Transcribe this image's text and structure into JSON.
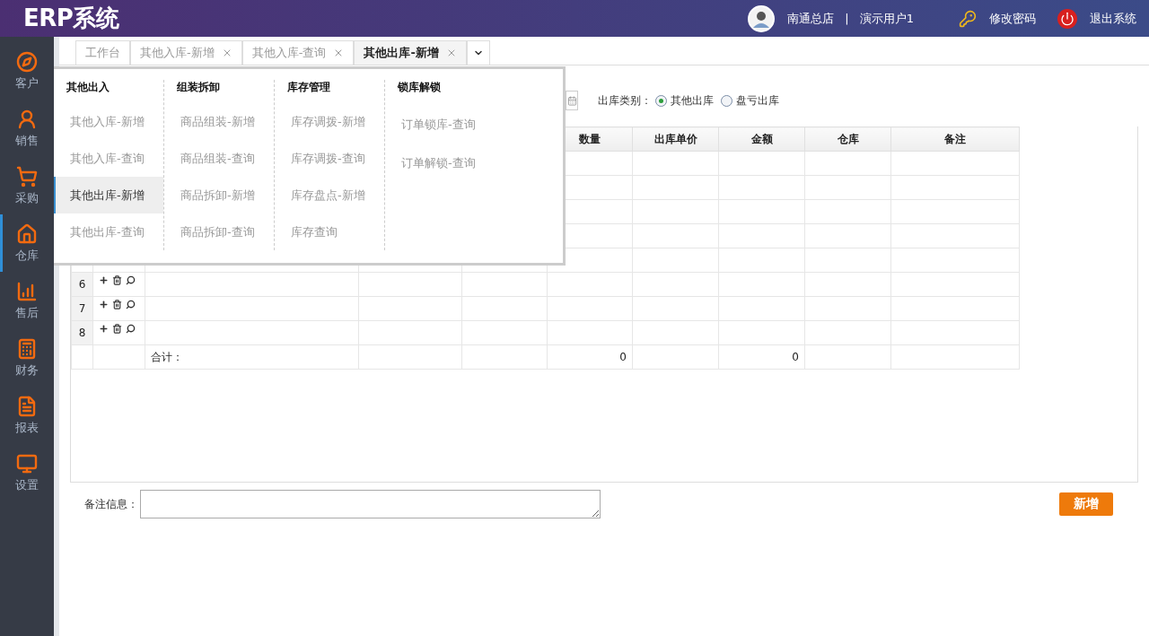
{
  "header": {
    "title": "ERP系统",
    "store": "南通总店",
    "separator": "|",
    "user": "演示用户1",
    "change_password": "修改密码",
    "logout": "退出系统"
  },
  "sidebar": {
    "items": [
      {
        "label": "客户",
        "selected": false
      },
      {
        "label": "销售",
        "selected": false
      },
      {
        "label": "采购",
        "selected": false
      },
      {
        "label": "仓库",
        "selected": true
      },
      {
        "label": "售后",
        "selected": false
      },
      {
        "label": "财务",
        "selected": false
      },
      {
        "label": "报表",
        "selected": false
      },
      {
        "label": "设置",
        "selected": false
      }
    ]
  },
  "tabs": [
    {
      "label": "工作台",
      "closable": false,
      "selected": false
    },
    {
      "label": "其他入库-新增",
      "closable": true,
      "selected": false
    },
    {
      "label": "其他入库-查询",
      "closable": true,
      "selected": false
    },
    {
      "label": "其他出库-新增",
      "closable": true,
      "selected": true
    }
  ],
  "menu": {
    "groups": [
      {
        "heading": "其他出入",
        "items": [
          {
            "label": "其他入库-新增",
            "selected": false
          },
          {
            "label": "其他入库-查询",
            "selected": false
          },
          {
            "label": "其他出库-新增",
            "selected": true
          },
          {
            "label": "其他出库-查询",
            "selected": false
          }
        ]
      },
      {
        "heading": "组装拆卸",
        "items": [
          {
            "label": "商品组装-新增",
            "selected": false
          },
          {
            "label": "商品组装-查询",
            "selected": false
          },
          {
            "label": "商品拆卸-新增",
            "selected": false
          },
          {
            "label": "商品拆卸-查询",
            "selected": false
          }
        ]
      },
      {
        "heading": "库存管理",
        "items": [
          {
            "label": "库存调拨-新增",
            "selected": false
          },
          {
            "label": "库存调拨-查询",
            "selected": false
          },
          {
            "label": "库存盘点-新增",
            "selected": false
          },
          {
            "label": "库存查询",
            "selected": false
          }
        ]
      },
      {
        "heading": "锁库解锁",
        "items": [
          {
            "label": "订单锁库-查询",
            "selected": false
          },
          {
            "label": "订单解锁-查询",
            "selected": false
          }
        ]
      }
    ]
  },
  "form": {
    "type_label": "出库类别：",
    "options": [
      {
        "label": "其他出库",
        "selected": true
      },
      {
        "label": "盘亏出库",
        "selected": false
      }
    ]
  },
  "table": {
    "columns": [
      "数量",
      "出库单价",
      "金额",
      "仓库",
      "备注"
    ],
    "rows": [
      {
        "number": "6"
      },
      {
        "number": "7"
      },
      {
        "number": "8"
      }
    ],
    "total": {
      "label": "合计：",
      "quantity": "0",
      "amount": "0"
    }
  },
  "remark": {
    "label": "备注信息："
  },
  "submit": "新增"
}
